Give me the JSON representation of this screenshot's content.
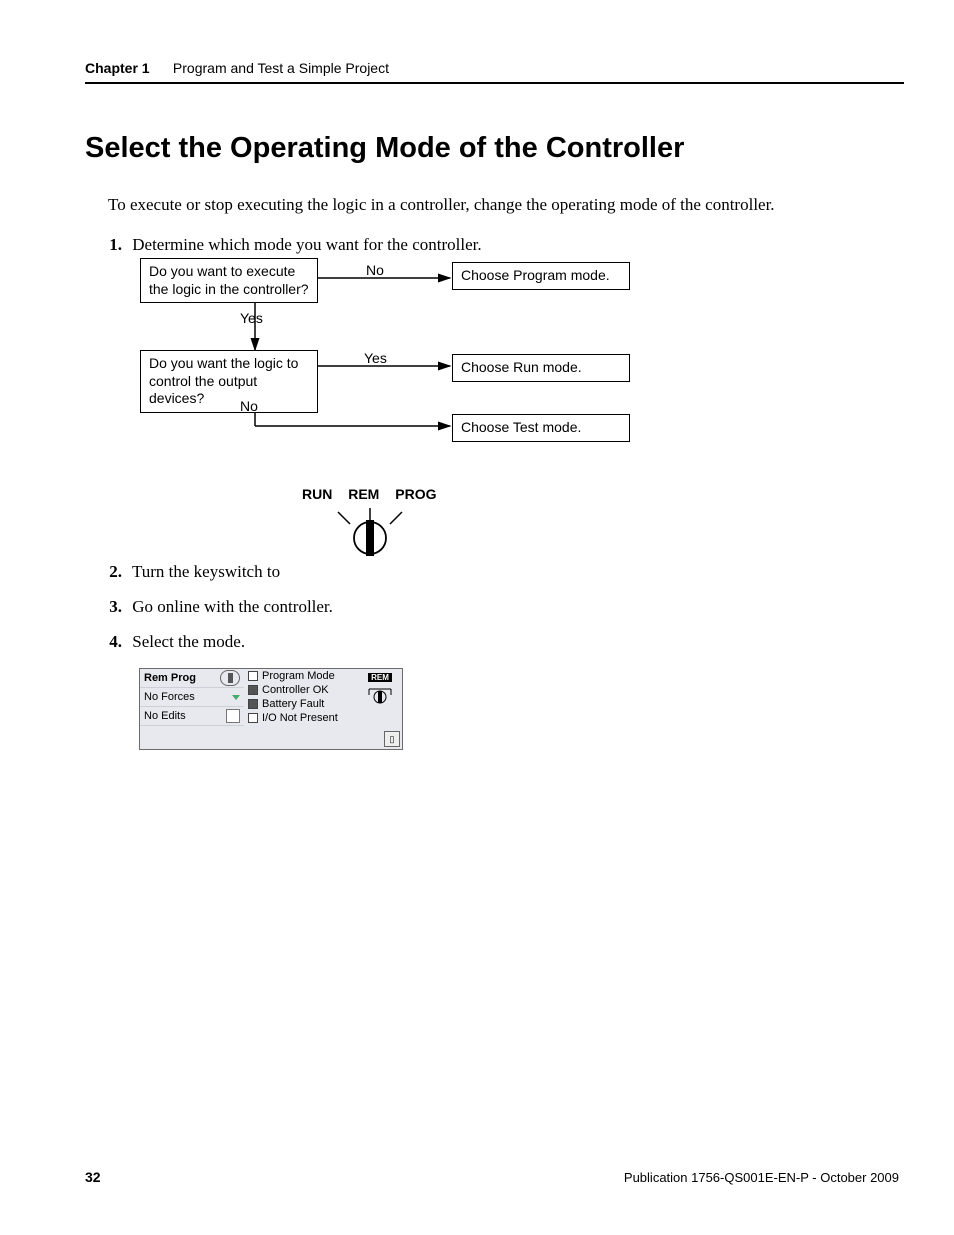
{
  "header": {
    "chapter": "Chapter 1",
    "title": "Program and Test a Simple Project"
  },
  "heading": "Select the Operating Mode of the Controller",
  "intro": "To execute or stop executing the logic in a controller, change the operating mode of the controller.",
  "steps": {
    "s1": {
      "num": "1.",
      "text": "Determine which mode you want for the controller."
    },
    "s2": {
      "num": "2.",
      "text": "Turn the keyswitch to"
    },
    "s3": {
      "num": "3.",
      "text": "Go online with the controller."
    },
    "s4": {
      "num": "4.",
      "text": "Select the mode."
    }
  },
  "flowchart": {
    "q1": "Do you want to execute the logic in the controller?",
    "q2": "Do you want the logic to control the output devices?",
    "no": "No",
    "yes": "Yes",
    "r1": "Choose Program mode.",
    "r2": "Choose Run mode.",
    "r3": "Choose Test mode."
  },
  "keyswitch": {
    "run": "RUN",
    "rem": "REM",
    "prog": "PROG"
  },
  "panel": {
    "left": {
      "rem_prog": "Rem Prog",
      "no_forces": "No Forces",
      "no_edits": "No Edits"
    },
    "mid": {
      "program_mode": "Program Mode",
      "controller_ok": "Controller OK",
      "battery_fault": "Battery Fault",
      "io_not_present": "I/O Not Present"
    },
    "rem_badge": "REM"
  },
  "footer": {
    "page": "32",
    "publication": "Publication 1756-QS001E-EN-P - October 2009"
  }
}
